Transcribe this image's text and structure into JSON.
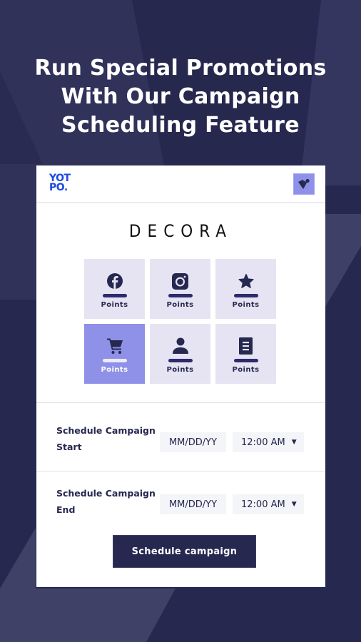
{
  "headline": {
    "line1": "Run Special Promotions",
    "line2": "With Our Campaign",
    "line3": "Scheduling Feature"
  },
  "colors": {
    "background": "#272850",
    "accent": "#8f90e8",
    "tile": "#e6e4f2",
    "brand_blue": "#1d49e0",
    "dark_navy": "#272850"
  },
  "card": {
    "logo": {
      "line1": "YOT",
      "line2": "PO."
    },
    "vip_badge_icon": "heart-icon",
    "brand_name": "DECORA",
    "tiles": [
      {
        "icon": "facebook-icon",
        "label": "Points",
        "active": false
      },
      {
        "icon": "instagram-icon",
        "label": "Points",
        "active": false
      },
      {
        "icon": "star-icon",
        "label": "Points",
        "active": false
      },
      {
        "icon": "shopping-cart-icon",
        "label": "Points",
        "active": true
      },
      {
        "icon": "user-icon",
        "label": "Points",
        "active": false
      },
      {
        "icon": "document-icon",
        "label": "Points",
        "active": false
      }
    ],
    "schedule_start": {
      "label_line1": "Schedule Campaign",
      "label_line2": "Start",
      "date_placeholder": "MM/DD/YY",
      "time_value": "12:00 AM"
    },
    "schedule_end": {
      "label_line1": "Schedule Campaign",
      "label_line2": "End",
      "date_placeholder": "MM/DD/YY",
      "time_value": "12:00 AM"
    },
    "button_label": "Schedule campaign"
  }
}
